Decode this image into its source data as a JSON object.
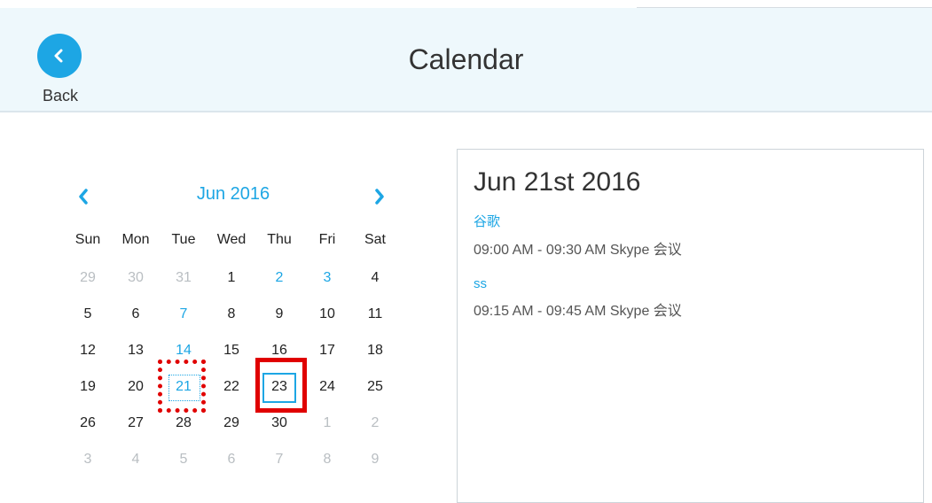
{
  "header": {
    "title": "Calendar",
    "back_label": "Back",
    "back_icon": "chevron-left-icon"
  },
  "calendar": {
    "month_label": "Jun 2016",
    "prev_icon": "chevron-left-icon",
    "next_icon": "chevron-right-icon",
    "weekdays": [
      "Sun",
      "Mon",
      "Tue",
      "Wed",
      "Thu",
      "Fri",
      "Sat"
    ],
    "weeks": [
      [
        {
          "d": "29",
          "s": "muted"
        },
        {
          "d": "30",
          "s": "muted"
        },
        {
          "d": "31",
          "s": "muted"
        },
        {
          "d": "1",
          "s": ""
        },
        {
          "d": "2",
          "s": "blue"
        },
        {
          "d": "3",
          "s": "blue"
        },
        {
          "d": "4",
          "s": ""
        }
      ],
      [
        {
          "d": "5",
          "s": ""
        },
        {
          "d": "6",
          "s": ""
        },
        {
          "d": "7",
          "s": "blue"
        },
        {
          "d": "8",
          "s": ""
        },
        {
          "d": "9",
          "s": ""
        },
        {
          "d": "10",
          "s": ""
        },
        {
          "d": "11",
          "s": ""
        }
      ],
      [
        {
          "d": "12",
          "s": ""
        },
        {
          "d": "13",
          "s": ""
        },
        {
          "d": "14",
          "s": "blue"
        },
        {
          "d": "15",
          "s": ""
        },
        {
          "d": "16",
          "s": ""
        },
        {
          "d": "17",
          "s": ""
        },
        {
          "d": "18",
          "s": ""
        }
      ],
      [
        {
          "d": "19",
          "s": ""
        },
        {
          "d": "20",
          "s": ""
        },
        {
          "d": "21",
          "s": "blue selected"
        },
        {
          "d": "22",
          "s": ""
        },
        {
          "d": "23",
          "s": "today"
        },
        {
          "d": "24",
          "s": ""
        },
        {
          "d": "25",
          "s": ""
        }
      ],
      [
        {
          "d": "26",
          "s": ""
        },
        {
          "d": "27",
          "s": ""
        },
        {
          "d": "28",
          "s": ""
        },
        {
          "d": "29",
          "s": ""
        },
        {
          "d": "30",
          "s": ""
        },
        {
          "d": "1",
          "s": "muted"
        },
        {
          "d": "2",
          "s": "muted"
        }
      ],
      [
        {
          "d": "3",
          "s": "muted"
        },
        {
          "d": "4",
          "s": "muted"
        },
        {
          "d": "5",
          "s": "muted"
        },
        {
          "d": "6",
          "s": "muted"
        },
        {
          "d": "7",
          "s": "muted"
        },
        {
          "d": "8",
          "s": "muted"
        },
        {
          "d": "9",
          "s": "muted"
        }
      ]
    ]
  },
  "details": {
    "date_label": "Jun 21st 2016",
    "events": [
      {
        "name": "谷歌",
        "time": "09:00 AM - 09:30 AM Skype 会议"
      },
      {
        "name": "ss",
        "time": "09:15 AM - 09:45 AM Skype 会议"
      }
    ]
  },
  "colors": {
    "accent": "#1da6e4",
    "header_bg": "#eef8fc",
    "annotation": "#e00000"
  }
}
